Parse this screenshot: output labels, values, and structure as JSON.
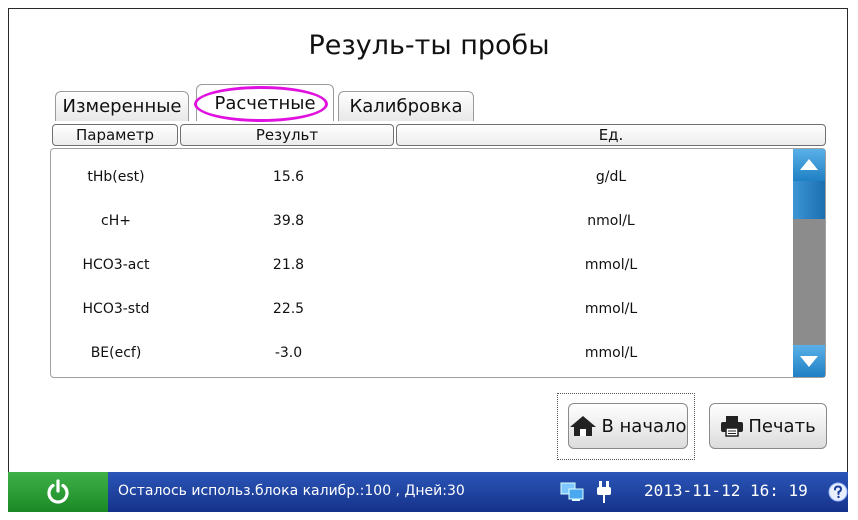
{
  "title": "Резуль-ты пробы",
  "tabs": [
    {
      "label": "Измеренные"
    },
    {
      "label": "Расчетные"
    },
    {
      "label": "Калибровка"
    }
  ],
  "columns": [
    "Параметр",
    "Результ",
    "Ед."
  ],
  "rows": [
    {
      "param": "tHb(est)",
      "value": "15.6",
      "unit": "g/dL"
    },
    {
      "param": "cH+",
      "value": "39.8",
      "unit": "nmol/L"
    },
    {
      "param": "HCO3-act",
      "value": "21.8",
      "unit": "mmol/L"
    },
    {
      "param": "HCO3-std",
      "value": "22.5",
      "unit": "mmol/L"
    },
    {
      "param": "BE(ecf)",
      "value": "-3.0",
      "unit": "mmol/L"
    }
  ],
  "buttons": {
    "home": "В начало",
    "print": "Печать"
  },
  "status": {
    "message": "Осталось использ.блока калибр.:100 , Дней:30",
    "datetime": "2013-11-12  16: 19"
  },
  "icons": [
    "power-icon",
    "home-icon",
    "printer-icon",
    "computer-icon",
    "plug-icon",
    "help-icon",
    "arrow-up-icon",
    "arrow-down-icon"
  ],
  "colors": {
    "status_bar": "#15328a",
    "power_button": "#2a9e34",
    "highlight": "#e010e0",
    "scroll_accent": "#1f80c4"
  }
}
